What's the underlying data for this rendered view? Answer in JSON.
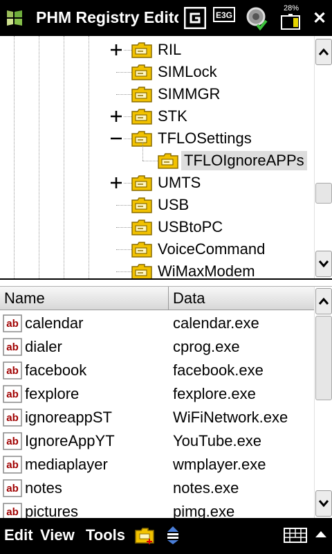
{
  "titlebar": {
    "title": "PHM Registry Editor",
    "battery": "28%"
  },
  "tree": {
    "items": [
      {
        "label": "RIL",
        "expander": "plus"
      },
      {
        "label": "SIMLock",
        "expander": ""
      },
      {
        "label": "SIMMGR",
        "expander": ""
      },
      {
        "label": "STK",
        "expander": "plus"
      },
      {
        "label": "TFLOSettings",
        "expander": "minus"
      },
      {
        "label": "TFLOIgnoreAPPs",
        "expander": "",
        "selected": true
      },
      {
        "label": "UMTS",
        "expander": "plus"
      },
      {
        "label": "USB",
        "expander": ""
      },
      {
        "label": "USBtoPC",
        "expander": ""
      },
      {
        "label": "VoiceCommand",
        "expander": ""
      },
      {
        "label": "WiMaxModem",
        "expander": ""
      }
    ]
  },
  "list": {
    "columns": {
      "name": "Name",
      "data": "Data"
    },
    "rows": [
      {
        "name": "calendar",
        "data": "calendar.exe"
      },
      {
        "name": "dialer",
        "data": "cprog.exe"
      },
      {
        "name": "facebook",
        "data": "facebook.exe"
      },
      {
        "name": "fexplore",
        "data": "fexplore.exe"
      },
      {
        "name": "ignoreappST",
        "data": "WiFiNetwork.exe"
      },
      {
        "name": "IgnoreAppYT",
        "data": "YouTube.exe"
      },
      {
        "name": "mediaplayer",
        "data": "wmplayer.exe"
      },
      {
        "name": "notes",
        "data": "notes.exe"
      },
      {
        "name": "pictures",
        "data": "pimg.exe"
      }
    ]
  },
  "menubar": {
    "edit": "Edit",
    "view": "View",
    "tools": "Tools"
  },
  "colors": {
    "folder": "#f2c200",
    "ab_icon_red": "#a00000"
  }
}
